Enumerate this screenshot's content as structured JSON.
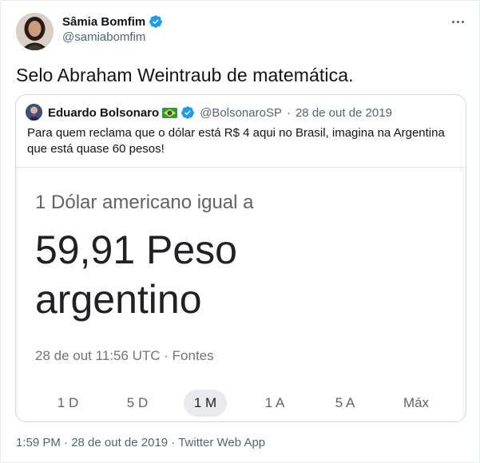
{
  "author": {
    "name": "Sâmia Bomfim",
    "handle": "@samiabomfim"
  },
  "tweet": {
    "text": "Selo Abraham Weintraub de matemática."
  },
  "quoted": {
    "name": "Eduardo Bolsonaro",
    "handle": "@BolsonaroSP",
    "separator": "·",
    "date": "28 de out de 2019",
    "text": "Para quem reclama que o dólar está R$ 4 aqui no Brasil, imagina na Argentina que está quase 60 pesos!",
    "media": {
      "label": "1 Dólar americano igual a",
      "value": "59,91 Peso argentino",
      "timestamp": "28 de out 11:56 UTC · Fontes",
      "ranges": [
        "1 D",
        "5 D",
        "1 M",
        "1 A",
        "5 A",
        "Máx"
      ],
      "active_range": "1 M"
    }
  },
  "footer": {
    "meta": "1:59 PM · 28 de out de 2019 · Twitter Web App"
  },
  "colors": {
    "verified": "#1d9bf0",
    "text": "#0f1419",
    "secondary": "#536471"
  }
}
